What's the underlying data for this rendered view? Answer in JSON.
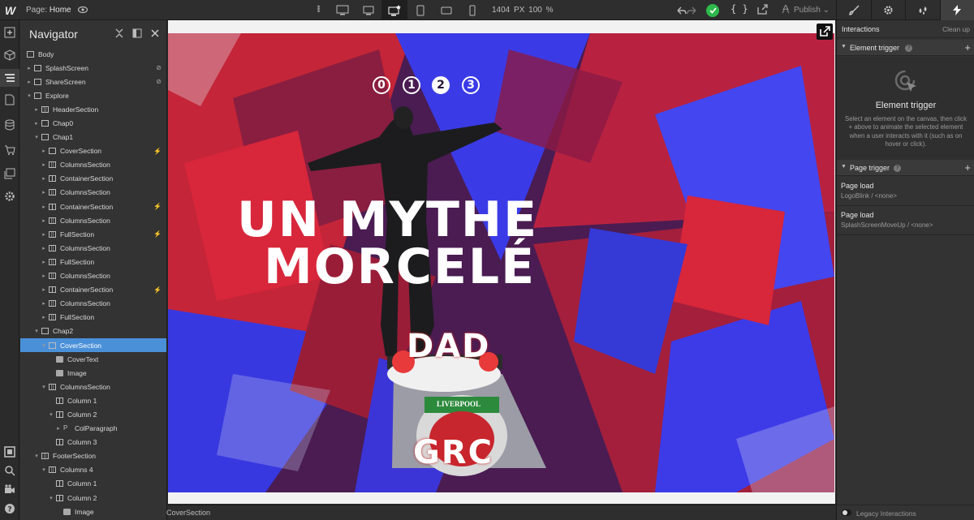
{
  "app": {
    "logo": "W",
    "page_label": "Page:",
    "page_name": "Home"
  },
  "toolbar": {
    "width": "1404",
    "unit": "PX",
    "zoom": "100 %",
    "code_label": "{ }",
    "publish_label": "Publish"
  },
  "right_tabs": [
    "style-brush",
    "settings-gear",
    "interactions-drops",
    "interactions-bolt"
  ],
  "navigator": {
    "title": "Navigator",
    "rows": [
      {
        "label": "Body",
        "depth": 0,
        "arrow": "",
        "icon": "box"
      },
      {
        "label": "SplashScreen",
        "depth": 1,
        "arrow": "▸",
        "icon": "box",
        "flag": "hidden"
      },
      {
        "label": "ShareScreen",
        "depth": 1,
        "arrow": "▸",
        "icon": "box",
        "flag": "hidden"
      },
      {
        "label": "Explore",
        "depth": 1,
        "arrow": "▾",
        "icon": "box"
      },
      {
        "label": "HeaderSection",
        "depth": 2,
        "arrow": "▸",
        "icon": "grid"
      },
      {
        "label": "Chap0",
        "depth": 2,
        "arrow": "▸",
        "icon": "box"
      },
      {
        "label": "Chap1",
        "depth": 2,
        "arrow": "▾",
        "icon": "box"
      },
      {
        "label": "CoverSection",
        "depth": 3,
        "arrow": "▸",
        "icon": "box",
        "flag": "bolt"
      },
      {
        "label": "ColumnsSection",
        "depth": 3,
        "arrow": "▸",
        "icon": "grid"
      },
      {
        "label": "ContainerSection",
        "depth": 3,
        "arrow": "▸",
        "icon": "col"
      },
      {
        "label": "ColumnsSection",
        "depth": 3,
        "arrow": "▸",
        "icon": "grid"
      },
      {
        "label": "ContainerSection",
        "depth": 3,
        "arrow": "▸",
        "icon": "col",
        "flag": "bolt"
      },
      {
        "label": "ColumnsSection",
        "depth": 3,
        "arrow": "▸",
        "icon": "grid"
      },
      {
        "label": "FullSection",
        "depth": 3,
        "arrow": "▸",
        "icon": "grid",
        "flag": "bolt"
      },
      {
        "label": "ColumnsSection",
        "depth": 3,
        "arrow": "▸",
        "icon": "grid"
      },
      {
        "label": "FullSection",
        "depth": 3,
        "arrow": "▸",
        "icon": "grid"
      },
      {
        "label": "ColumnsSection",
        "depth": 3,
        "arrow": "▸",
        "icon": "grid"
      },
      {
        "label": "ContainerSection",
        "depth": 3,
        "arrow": "▸",
        "icon": "col",
        "flag": "bolt"
      },
      {
        "label": "ColumnsSection",
        "depth": 3,
        "arrow": "▸",
        "icon": "grid"
      },
      {
        "label": "FullSection",
        "depth": 3,
        "arrow": "▸",
        "icon": "grid"
      },
      {
        "label": "Chap2",
        "depth": 2,
        "arrow": "▾",
        "icon": "box"
      },
      {
        "label": "CoverSection",
        "depth": 3,
        "arrow": "▾",
        "icon": "box",
        "selected": true
      },
      {
        "label": "CoverText",
        "depth": 4,
        "arrow": "",
        "icon": "img"
      },
      {
        "label": "Image",
        "depth": 4,
        "arrow": "",
        "icon": "img"
      },
      {
        "label": "ColumnsSection",
        "depth": 3,
        "arrow": "▾",
        "icon": "grid"
      },
      {
        "label": "Column 1",
        "depth": 4,
        "arrow": "",
        "icon": "col"
      },
      {
        "label": "Column 2",
        "depth": 4,
        "arrow": "▾",
        "icon": "col"
      },
      {
        "label": "ColParagraph",
        "depth": 5,
        "arrow": "▸",
        "icon": "txt"
      },
      {
        "label": "Column 3",
        "depth": 4,
        "arrow": "",
        "icon": "col"
      },
      {
        "label": "FooterSection",
        "depth": 2,
        "arrow": "▾",
        "icon": "grid"
      },
      {
        "label": "Columns 4",
        "depth": 3,
        "arrow": "▾",
        "icon": "grid"
      },
      {
        "label": "Column 1",
        "depth": 4,
        "arrow": "",
        "icon": "col"
      },
      {
        "label": "Column 2",
        "depth": 4,
        "arrow": "▾",
        "icon": "col"
      },
      {
        "label": "Image",
        "depth": 5,
        "arrow": "",
        "icon": "img"
      }
    ]
  },
  "canvas": {
    "chapters": [
      "0",
      "1",
      "2",
      "3"
    ],
    "active_chapter": "2",
    "headline_line1": "UN MYTHE",
    "headline_line2": "MORCELÉ",
    "wreath_top": "DAD",
    "wreath_crest": "LIVERPOOL",
    "wreath_bottom": "GRC"
  },
  "breadcrumb": {
    "current": "CoverSection"
  },
  "interactions": {
    "title": "Interactions",
    "clean_up": "Clean up",
    "element_trigger": {
      "heading": "Element trigger",
      "title": "Element trigger",
      "description": "Select an element on the canvas, then click + above to animate the selected element when a user interacts with it (such as on hover or click)."
    },
    "page_trigger": {
      "heading": "Page trigger",
      "items": [
        {
          "event": "Page load",
          "detail": "LogoBlink / <none>"
        },
        {
          "event": "Page load",
          "detail": "SplashScreenMoveUp / <none>"
        }
      ]
    },
    "legacy": "Legacy Interactions"
  },
  "colors": {
    "accent": "#4a90d9",
    "success": "#2fb84c",
    "panel": "#333333",
    "art_red": "#d8263b",
    "art_blue": "#3d3be8"
  }
}
